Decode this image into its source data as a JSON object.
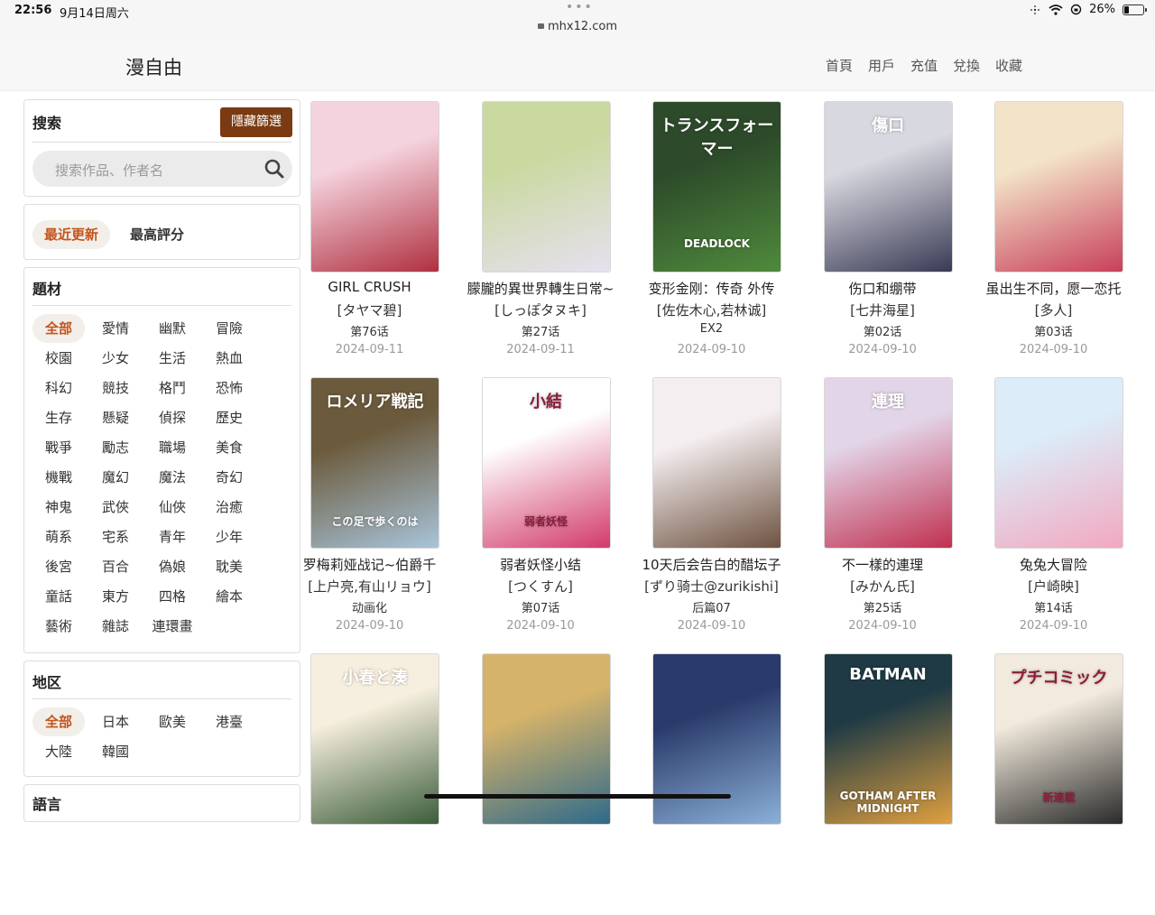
{
  "status_bar": {
    "time": "22:56",
    "date": "9月14日周六",
    "url": "mhx12.com",
    "battery": "26%",
    "battery_level": 0.26
  },
  "header": {
    "brand": "漫自由",
    "nav": [
      "首頁",
      "用戶",
      "充值",
      "兌換",
      "收藏"
    ]
  },
  "sidebar": {
    "search": {
      "title": "搜索",
      "hide_button": "隱藏篩選",
      "placeholder": "搜索作品、作者名"
    },
    "sort": {
      "options": [
        "最近更新",
        "最高評分"
      ],
      "active": "最近更新"
    },
    "genre": {
      "title": "題材",
      "tags": [
        "全部",
        "愛情",
        "幽默",
        "冒險",
        "校園",
        "少女",
        "生活",
        "熱血",
        "科幻",
        "競技",
        "格鬥",
        "恐怖",
        "生存",
        "懸疑",
        "偵探",
        "歷史",
        "戰爭",
        "勵志",
        "職場",
        "美食",
        "機戰",
        "魔幻",
        "魔法",
        "奇幻",
        "神鬼",
        "武俠",
        "仙俠",
        "治癒",
        "萌系",
        "宅系",
        "青年",
        "少年",
        "後宮",
        "百合",
        "偽娘",
        "耽美",
        "童話",
        "東方",
        "四格",
        "繪本",
        "藝術",
        "雜誌",
        "連環畫"
      ]
    },
    "region": {
      "title": "地区",
      "tags": [
        "全部",
        "日本",
        "歐美",
        "港臺",
        "大陸",
        "韓國"
      ]
    },
    "language": {
      "title": "語言"
    }
  },
  "comics": [
    {
      "title": "GIRL CRUSH",
      "author": "[タヤマ碧]",
      "chapter": "第76话",
      "date": "2024-09-11",
      "colors": [
        "#f5d3de",
        "#b03040"
      ]
    },
    {
      "title": "朦朧的異世界轉生日常~",
      "author": "[しっぽタヌキ]",
      "chapter": "第27话",
      "date": "2024-09-11",
      "colors": [
        "#c9d9a0",
        "#e7e0f0"
      ]
    },
    {
      "title": "变形金刚：传奇 外传",
      "author": "[佐佐木心,若林诚]",
      "chapter": "EX2",
      "date": "2024-09-10",
      "colors": [
        "#2d4a2a",
        "#4f8a3c"
      ]
    },
    {
      "title": "伤口和绷带",
      "author": "[七井海星]",
      "chapter": "第02话",
      "date": "2024-09-10",
      "colors": [
        "#d8d8e0",
        "#3a3a55"
      ]
    },
    {
      "title": "虽出生不同，愿一恋托",
      "author": "[多人]",
      "chapter": "第03话",
      "date": "2024-09-10",
      "colors": [
        "#f3e3c8",
        "#c8405a"
      ]
    },
    {
      "title": "罗梅莉娅战记~伯爵千",
      "author": "[上户亮,有山リョウ]",
      "chapter": "动画化",
      "date": "2024-09-10",
      "colors": [
        "#6b5a3c",
        "#a8c4da"
      ]
    },
    {
      "title": "弱者妖怪小结",
      "author": "[つくすん]",
      "chapter": "第07话",
      "date": "2024-09-10",
      "colors": [
        "#ffffff",
        "#d23a6a"
      ]
    },
    {
      "title": "10天后会告白的醋坛子",
      "author": "[ずり骑士@zurikishi]",
      "chapter": "后篇07",
      "date": "2024-09-10",
      "colors": [
        "#f4eef0",
        "#6e5240"
      ]
    },
    {
      "title": "不一樣的連理",
      "author": "[みかん氏]",
      "chapter": "第25话",
      "date": "2024-09-10",
      "colors": [
        "#e3d5e8",
        "#c03050"
      ]
    },
    {
      "title": "兔兔大冒险",
      "author": "[户崎映]",
      "chapter": "第14话",
      "date": "2024-09-10",
      "colors": [
        "#dcecf8",
        "#f2a8c0"
      ]
    },
    {
      "title": "",
      "author": "",
      "chapter": "",
      "date": "",
      "colors": [
        "#f6eede",
        "#3b5d3a"
      ]
    },
    {
      "title": "",
      "author": "",
      "chapter": "",
      "date": "",
      "colors": [
        "#d6b36a",
        "#2e6a8a"
      ]
    },
    {
      "title": "",
      "author": "",
      "chapter": "",
      "date": "",
      "colors": [
        "#2a3a6a",
        "#8ab0d8"
      ]
    },
    {
      "title": "",
      "author": "",
      "chapter": "",
      "date": "",
      "colors": [
        "#1f3a44",
        "#e0a040"
      ]
    },
    {
      "title": "",
      "author": "",
      "chapter": "",
      "date": "",
      "colors": [
        "#f2eadc",
        "#2a2a2a"
      ]
    }
  ],
  "cover_text": {
    "c2": [
      "トランスフォーマー",
      "DEADLOCK"
    ],
    "c3": [
      "傷口"
    ],
    "c5": [
      "ロメリア戦記",
      "この足で歩くのは"
    ],
    "c6": [
      "小結",
      "弱者妖怪"
    ],
    "c8": [
      "連理"
    ],
    "c10": [
      "小春と湊"
    ],
    "c13": [
      "BATMAN",
      "GOTHAM AFTER MIDNIGHT"
    ],
    "c14": [
      "プチコミック",
      "新連載"
    ]
  }
}
